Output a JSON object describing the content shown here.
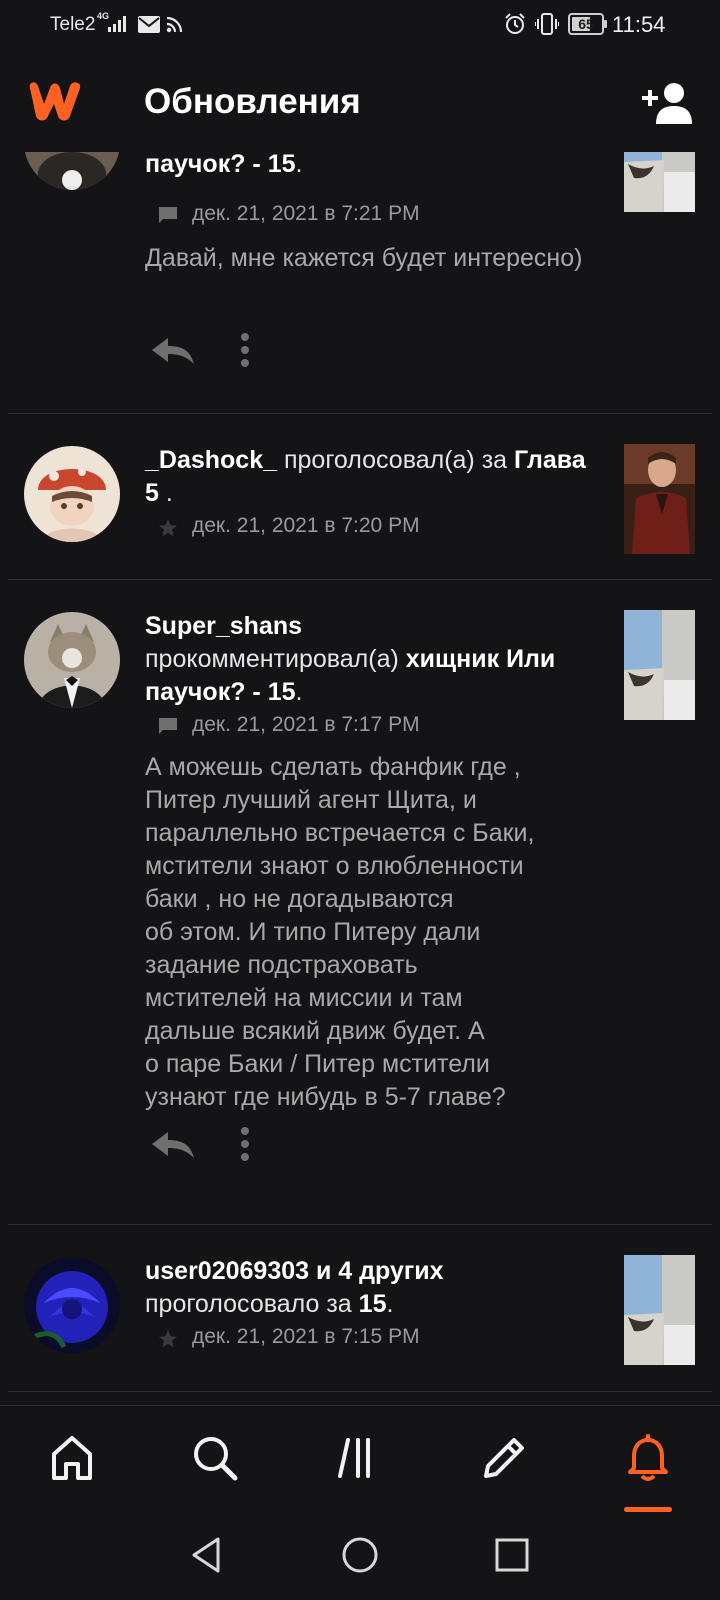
{
  "status_bar": {
    "carrier": "Tele2",
    "network_type": "4G",
    "battery_percent": "65",
    "battery_level": 0.65,
    "time": "11:54"
  },
  "header": {
    "title": "Обновления"
  },
  "feed": [
    {
      "headline_tail": "паучок? - 15",
      "headline_end": ".",
      "meta_icon": "comment-icon",
      "time": "дек. 21, 2021 в 7:21 PM",
      "body": "Давай, мне кажется будет интересно)"
    },
    {
      "user": "_Dashock_",
      "action": " проголосовал(а) за ",
      "target": "Глава 5",
      "target_end": " .",
      "meta_icon": "star-icon",
      "time": "дек. 21, 2021 в 7:20 PM"
    },
    {
      "user": "Super_shans",
      "action": "прокомментировал(а) ",
      "target": "хищник Или паучок? - 15",
      "target_end": ".",
      "meta_icon": "comment-icon",
      "time": "дек. 21, 2021 в 7:17 PM",
      "body_lines": [
        "А можешь сделать фанфик где ,",
        "Питер лучший агент Щита, и",
        "параллельно встречается с Баки,",
        "мстители знают о влюбленности",
        "баки , но не догадываются",
        "об этом. И типо Питеру дали",
        "задание подстраховать",
        "мстителей на миссии и там",
        "дальше всякий движ будет. А",
        "о паре Баки / Питер мстители",
        "узнают где нибудь в 5-7 главе?"
      ]
    },
    {
      "user": "user02069303 и 4 других",
      "action": "проголосовало за ",
      "target": "15",
      "target_end": ".",
      "meta_icon": "star-icon",
      "time": "дек. 21, 2021 в 7:15 PM"
    }
  ],
  "bottom_nav": {
    "items": [
      "home-icon",
      "search-icon",
      "library-icon",
      "write-icon",
      "notifications-icon"
    ],
    "active": "notifications-icon"
  },
  "colors": {
    "background": "#141316",
    "accent": "#ff6122",
    "text_primary": "#ffffff",
    "text_secondary": "#a9a9a9",
    "text_meta": "#9a9a9a"
  }
}
